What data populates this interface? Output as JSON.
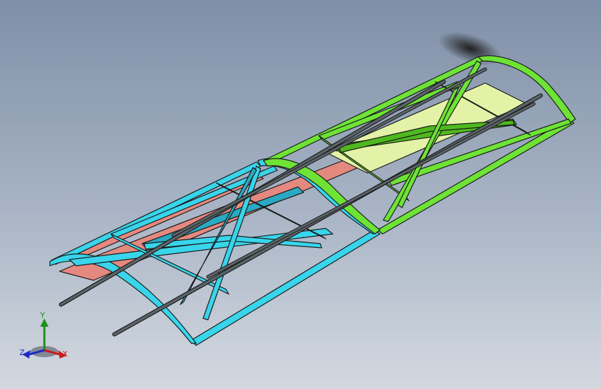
{
  "viewport": {
    "background_top": "#7f8fa7",
    "background_bottom": "#d4d9e0"
  },
  "model": {
    "panel_left_color": "#38d5eb",
    "panel_left_shade": "#2aa9c2",
    "panel_right_color": "#6ee336",
    "panel_right_shade": "#4fb81f",
    "skin_strip_color": "#e4897f",
    "skin_strip_right_color": "#e3f2a6",
    "rod_color": "#5b6468",
    "outline_color": "#1a1a1a"
  },
  "triad": {
    "x_label": "X",
    "y_label": "Y",
    "z_label": "Z",
    "x_color": "#c91d1d",
    "y_color": "#1c8f1c",
    "z_color": "#1b2bc4"
  }
}
